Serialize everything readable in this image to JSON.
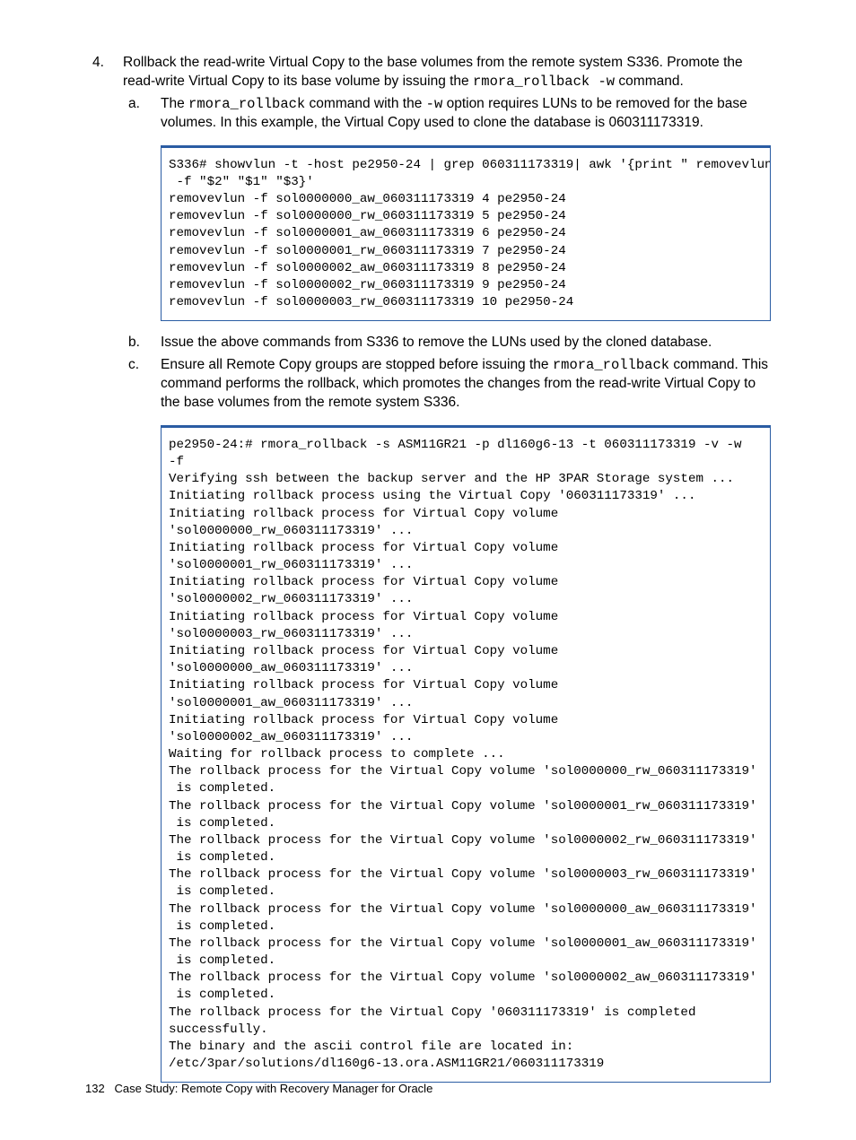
{
  "step4": {
    "num": "4.",
    "para_pre": "Rollback the read-write Virtual Copy to the base volumes from the remote system S336. Promote the read-write Virtual Copy to its base volume by issuing the ",
    "cmd": "rmora_rollback -w",
    "para_post": " command.",
    "a": {
      "num": "a.",
      "pre1": "The ",
      "cmd1": "rmora_rollback",
      "mid1": " command with the ",
      "opt1": "-w",
      "post1": " option requires LUNs to be removed for the base volumes. In this example, the Virtual Copy used to clone the database is 060311173319."
    },
    "code1": "S336# showvlun -t -host pe2950-24 | grep 060311173319| awk '{print \" removevlun\n -f \"$2\" \"$1\" \"$3}'\nremovevlun -f sol0000000_aw_060311173319 4 pe2950-24\nremovevlun -f sol0000000_rw_060311173319 5 pe2950-24\nremovevlun -f sol0000001_aw_060311173319 6 pe2950-24\nremovevlun -f sol0000001_rw_060311173319 7 pe2950-24\nremovevlun -f sol0000002_aw_060311173319 8 pe2950-24\nremovevlun -f sol0000002_rw_060311173319 9 pe2950-24\nremovevlun -f sol0000003_rw_060311173319 10 pe2950-24",
    "b": {
      "num": "b.",
      "text": "Issue the above commands from S336 to remove the LUNs used by the cloned database."
    },
    "c": {
      "num": "c.",
      "pre": "Ensure all Remote Copy groups are stopped before issuing the ",
      "cmd": "rmora_rollback",
      "post": " command. This command performs the rollback, which promotes the changes from the read-write Virtual Copy to the base volumes from the remote system S336."
    },
    "code2": "pe2950-24:# rmora_rollback -s ASM11GR21 -p dl160g6-13 -t 060311173319 -v -w\n-f\nVerifying ssh between the backup server and the HP 3PAR Storage system ...\nInitiating rollback process using the Virtual Copy '060311173319' ...\nInitiating rollback process for Virtual Copy volume\n'sol0000000_rw_060311173319' ...\nInitiating rollback process for Virtual Copy volume\n'sol0000001_rw_060311173319' ...\nInitiating rollback process for Virtual Copy volume\n'sol0000002_rw_060311173319' ...\nInitiating rollback process for Virtual Copy volume\n'sol0000003_rw_060311173319' ...\nInitiating rollback process for Virtual Copy volume\n'sol0000000_aw_060311173319' ...\nInitiating rollback process for Virtual Copy volume\n'sol0000001_aw_060311173319' ...\nInitiating rollback process for Virtual Copy volume\n'sol0000002_aw_060311173319' ...\nWaiting for rollback process to complete ...\nThe rollback process for the Virtual Copy volume 'sol0000000_rw_060311173319'\n is completed.\nThe rollback process for the Virtual Copy volume 'sol0000001_rw_060311173319'\n is completed.\nThe rollback process for the Virtual Copy volume 'sol0000002_rw_060311173319'\n is completed.\nThe rollback process for the Virtual Copy volume 'sol0000003_rw_060311173319'\n is completed.\nThe rollback process for the Virtual Copy volume 'sol0000000_aw_060311173319'\n is completed.\nThe rollback process for the Virtual Copy volume 'sol0000001_aw_060311173319'\n is completed.\nThe rollback process for the Virtual Copy volume 'sol0000002_aw_060311173319'\n is completed.\nThe rollback process for the Virtual Copy '060311173319' is completed\nsuccessfully.\nThe binary and the ascii control file are located in:\n/etc/3par/solutions/dl160g6-13.ora.ASM11GR21/060311173319"
  },
  "footer": {
    "page": "132",
    "title": "Case Study: Remote Copy with Recovery Manager for Oracle"
  }
}
